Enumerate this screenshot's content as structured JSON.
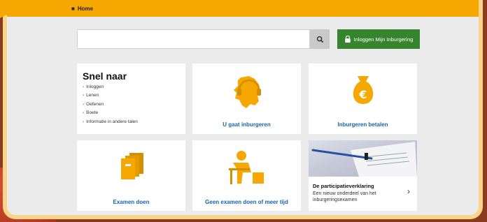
{
  "breadcrumb": {
    "home_label": "Home"
  },
  "search": {
    "placeholder": "",
    "value": ""
  },
  "login": {
    "label": "Inloggen Mijn Inburgering"
  },
  "snel": {
    "title": "Snel naar",
    "links": [
      "Inloggen",
      "Lenen",
      "Oefenen",
      "Boete",
      "Informatie in andere talen"
    ]
  },
  "tiles": {
    "u_gaat": "U gaat inburgeren",
    "betalen": "Inburgeren betalen",
    "examen": "Examen doen",
    "geen_examen": "Geen examen doen of meer tijd"
  },
  "news": {
    "title": "De participatieverklaring",
    "text": "Een nieuw onderdeel van het inburgeringsexamen"
  },
  "colors": {
    "accent_orange": "#f6a800",
    "link_blue": "#1a63a8",
    "login_green": "#37842f",
    "icon_yellow": "#f6a800"
  }
}
